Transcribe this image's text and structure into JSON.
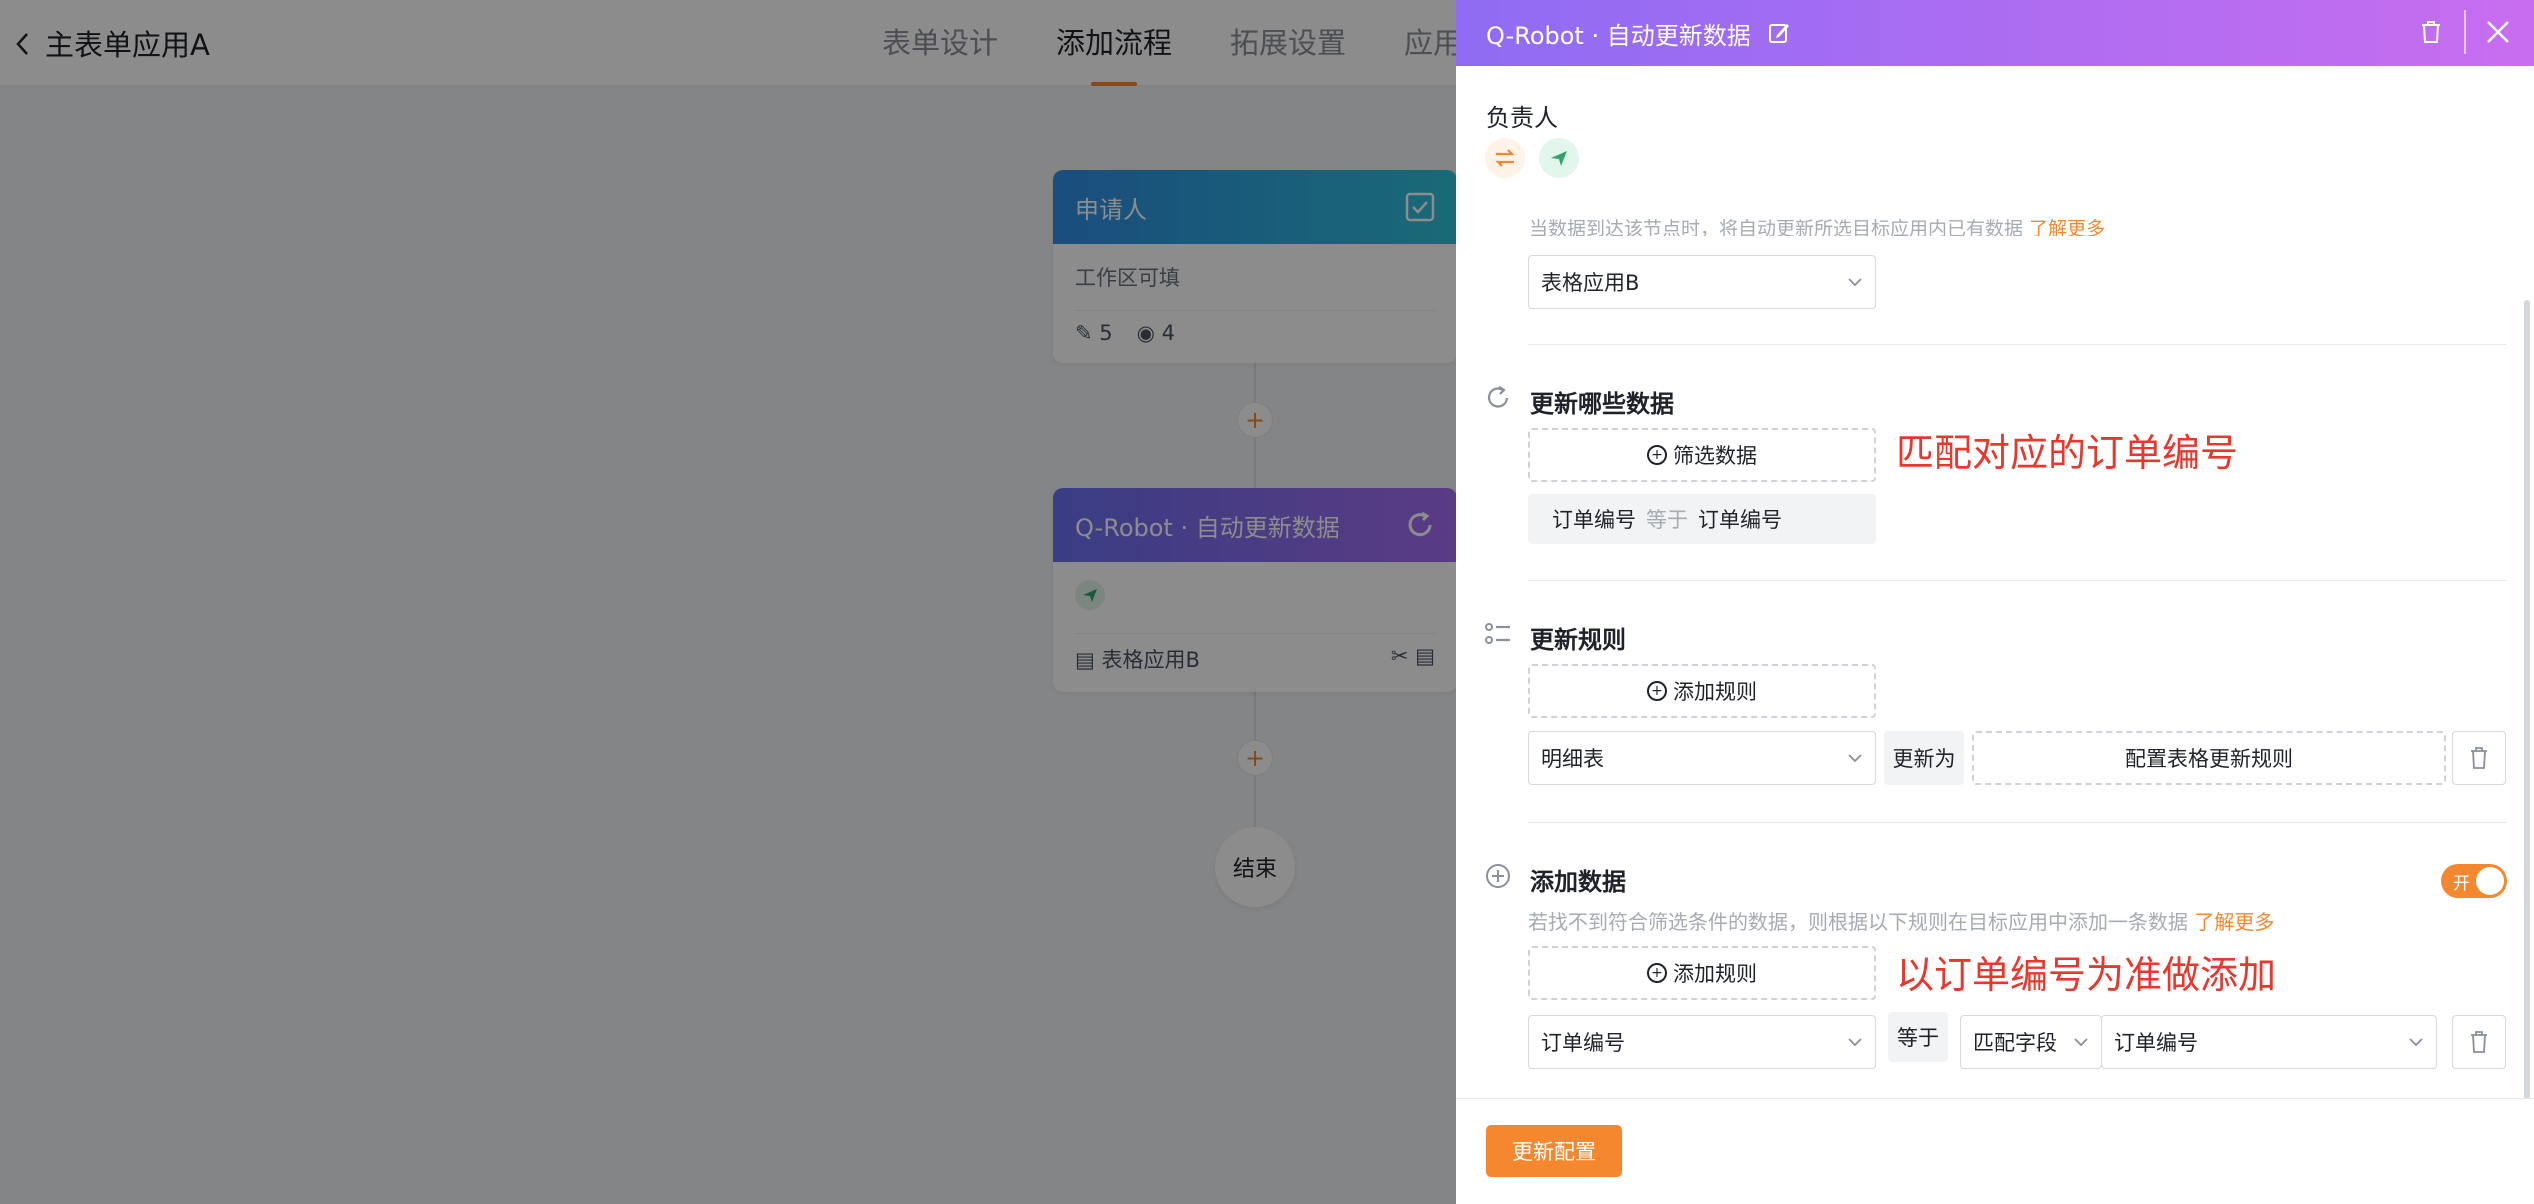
{
  "app": {
    "title": "主表单应用A",
    "tabs": [
      {
        "label": "表单设计",
        "active": false
      },
      {
        "label": "添加流程",
        "active": true
      },
      {
        "label": "拓展设置",
        "active": false
      },
      {
        "label": "应用",
        "active": false
      }
    ]
  },
  "canvas": {
    "node1": {
      "title": "申请人",
      "body": "工作区可填",
      "edit_count": "5",
      "view_count": "4"
    },
    "node2": {
      "title": "Q-Robot · 自动更新数据",
      "app_label": "表格应用B"
    },
    "end_label": "结束",
    "add_symbol": "+"
  },
  "drawer": {
    "title": "Q-Robot · 自动更新数据",
    "owner_label": "负责人",
    "hint_text": "当数据到达该节点时，将自动更新所选目标应用内已有数据",
    "hint_link": "了解更多",
    "target_app": "表格应用B",
    "update_which": {
      "title": "更新哪些数据",
      "filter_button": "筛选数据",
      "annotation": "匹配对应的订单编号",
      "condition": {
        "field": "订单编号",
        "operator": "等于",
        "value": "订单编号"
      }
    },
    "update_rule": {
      "title": "更新规则",
      "add_button": "添加规则",
      "field": "明细表",
      "update_to": "更新为",
      "config_button": "配置表格更新规则"
    },
    "add_data": {
      "title": "添加数据",
      "toggle_label": "开",
      "toggle_on": true,
      "description": "若找不到符合筛选条件的数据，则根据以下规则在目标应用中添加一条数据",
      "desc_link": "了解更多",
      "add_button": "添加规则",
      "annotation": "以订单编号为准做添加",
      "field": "订单编号",
      "equals": "等于",
      "match_type": "匹配字段",
      "match_value": "订单编号"
    },
    "footer_button": "更新配置"
  },
  "colors": {
    "accent": "#f5882f",
    "annotation": "#e8372c",
    "drawer_header_start": "#8f6cf3",
    "drawer_header_end": "#c86df0"
  }
}
